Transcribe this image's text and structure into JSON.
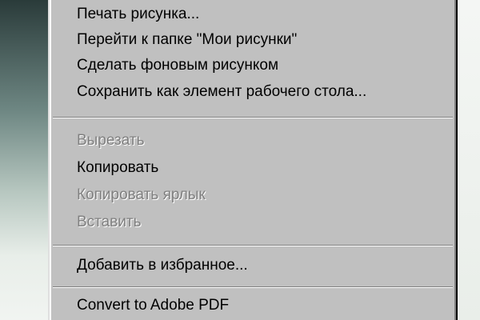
{
  "context_menu": {
    "items": [
      {
        "label": "Печать рисунка...",
        "enabled": true
      },
      {
        "label": "Перейти к папке \"Мои рисунки\"",
        "enabled": true
      },
      {
        "label": "Сделать фоновым рисунком",
        "enabled": true
      },
      {
        "label": "Сохранить как элемент рабочего стола...",
        "enabled": true
      },
      {
        "label": "Вырезать",
        "enabled": false
      },
      {
        "label": "Копировать",
        "enabled": true
      },
      {
        "label": "Копировать ярлык",
        "enabled": false
      },
      {
        "label": "Вставить",
        "enabled": false
      },
      {
        "label": "Добавить в избранное...",
        "enabled": true
      },
      {
        "label": "Convert to Adobe PDF",
        "enabled": true
      }
    ]
  },
  "colors": {
    "menu_background": "#c0c0c0",
    "disabled_text": "#808080",
    "enabled_text": "#000000"
  }
}
